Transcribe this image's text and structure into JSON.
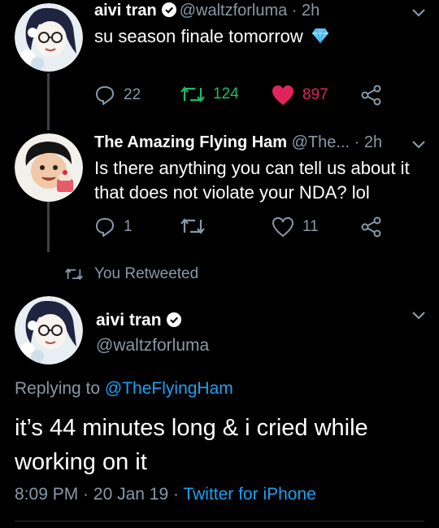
{
  "colors": {
    "background": "#000000",
    "text": "#ffffff",
    "secondary": "#8899a6",
    "link": "#1da1f2",
    "retweet_green": "#17bf63",
    "like_red": "#e0245e",
    "verified_blue": "#1da1f2"
  },
  "tweet1": {
    "name": "aivi tran",
    "handle": "@waltzforluma",
    "time": "· 2h",
    "text": "su season finale tomorrow",
    "emoji_icon": "gem-icon",
    "replies": "22",
    "retweets": "124",
    "likes": "897"
  },
  "tweet2": {
    "name": "The Amazing Flying Ham",
    "handle": "@The...",
    "time": "· 2h",
    "text_line1": "Is there anything you can tell us about it",
    "text_line2": "that does not violate your NDA? lol",
    "replies": "1",
    "retweets": "",
    "likes": "11"
  },
  "retweeted": {
    "label": "You Retweeted"
  },
  "main_tweet": {
    "name": "aivi tran",
    "handle": "@waltzforluma",
    "replying_prefix": "Replying to",
    "replying_to": "@TheFlyingHam",
    "text_line1": "it’s 44 minutes long & i cried while",
    "text_line2": "working on it",
    "time": "8:09 PM",
    "sep1": " · ",
    "date": "20 Jan 19",
    "sep2": " · ",
    "source": "Twitter for iPhone"
  }
}
